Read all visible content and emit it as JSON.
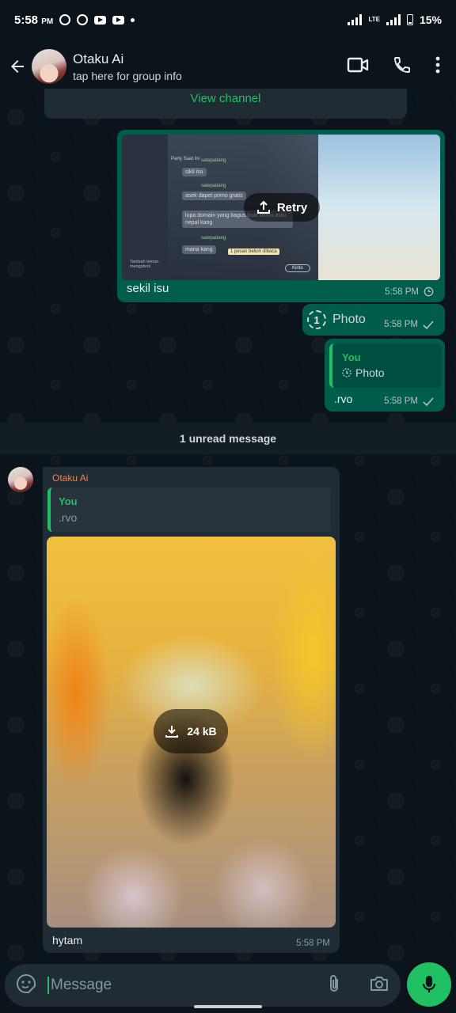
{
  "status_bar": {
    "time": "5:58",
    "time_suffix": "PM",
    "battery": "15%",
    "network": "LTE"
  },
  "header": {
    "title": "Otaku Ai",
    "subtitle": "tap here for group info"
  },
  "channel_card": {
    "link": "View channel"
  },
  "messages": {
    "m1": {
      "caption": "sekil isu",
      "time": "5:58 PM",
      "retry_label": "Retry",
      "thumb_text": {
        "title": "Party Saat Ini",
        "user": "satepadang",
        "msg1": "sikil isu",
        "msg2": "asek dapet primo gratis",
        "msg3": "lupa domain yang bagus buat farmu atau nepal kang",
        "msg4": "mana kang",
        "unread": "1 pesan belum dibaca",
        "nick": "Kirito",
        "footer": "Tambah teman mengobrol"
      }
    },
    "m2": {
      "label": "Photo",
      "view_once": "1",
      "time": "5:58 PM"
    },
    "m3": {
      "quote_author": "You",
      "quote_text": "Photo",
      "text": ".rvo",
      "time": "5:58 PM"
    },
    "unread": "1 unread message",
    "m4": {
      "sender": "Otaku Ai",
      "quote_author": "You",
      "quote_text": ".rvo",
      "size": "24 kB",
      "caption": "hytam",
      "time": "5:58 PM"
    }
  },
  "composer": {
    "placeholder": "Message"
  },
  "colors": {
    "accent": "#21c063",
    "outgoing": "#005c4b",
    "incoming": "#1f2c34",
    "sender_name": "#f0834f"
  }
}
